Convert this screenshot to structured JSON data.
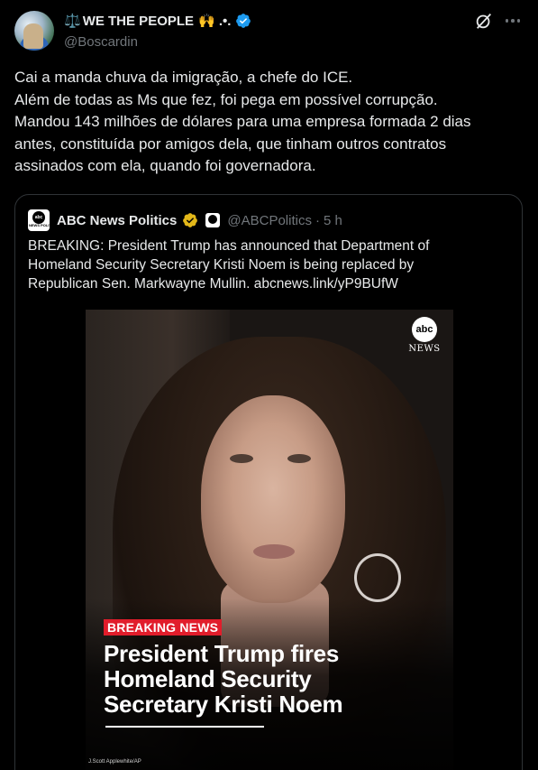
{
  "author": {
    "display_name": "WE THE PEOPLE",
    "name_prefix_emoji": "⚖️",
    "name_suffix_emoji": "🙌 .•.",
    "handle": "@Boscardin",
    "verified": true
  },
  "header_icons": [
    "grok-icon",
    "more-icon"
  ],
  "tweet": {
    "lines": [
      "Cai a manda chuva da imigração, a chefe do ICE.",
      "Além de todas as Ms que fez, foi pega em possível corrupção.",
      "Mandou 143 milhões de dólares para uma empresa formada 2 dias",
      "antes, constituída por amigos dela, que tinham outros contratos",
      "assinados com ela, quando foi governadora."
    ]
  },
  "quote": {
    "logo_text": "abc",
    "logo_sub": "NEWS POLITICS",
    "name": "ABC News Politics",
    "handle": "@ABCPolitics",
    "separator": "·",
    "time": "5 h",
    "text_lines": [
      "BREAKING: President Trump has announced that Department of",
      "Homeland Security Secretary Kristi Noem is being replaced by",
      "Republican Sen. Markwayne Mullin. abcnews.link/yP9BUfW"
    ],
    "media": {
      "logo_ball": "abc",
      "logo_news": "NEWS",
      "breaking_label": "BREAKING NEWS",
      "headline_lines": [
        "President Trump fires",
        "Homeland Security",
        "Secretary Kristi Noem"
      ],
      "credit": "J.Scott Applewhite/AP"
    }
  },
  "colors": {
    "background": "#000000",
    "text": "#e7e9ea",
    "secondary": "#71767b",
    "verified_blue": "#1d9bf0",
    "verified_gold": "#e2b719",
    "breaking_red": "#e11d2b"
  }
}
